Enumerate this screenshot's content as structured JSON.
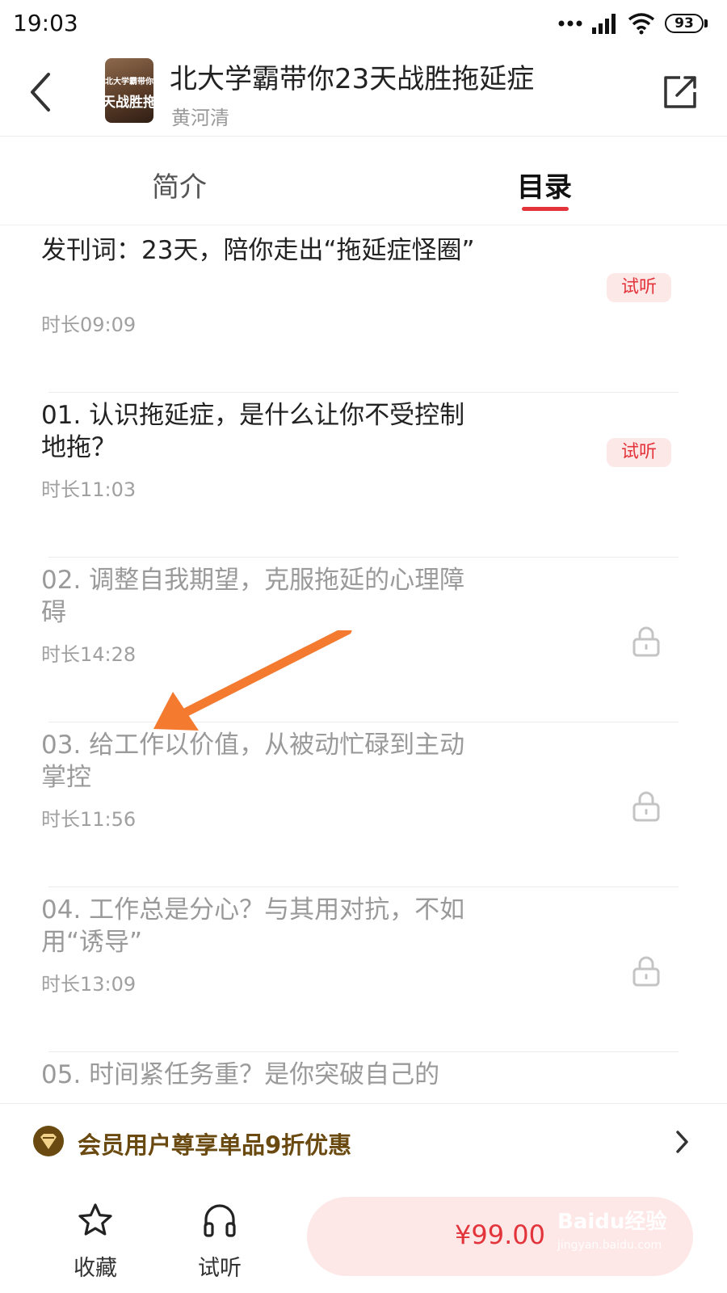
{
  "status_bar": {
    "time": "19:03",
    "battery": "93"
  },
  "header": {
    "title": "北大学霸带你23天战胜拖延症",
    "author": "黄河清",
    "cover_text_top": "北大学霸带你",
    "cover_text_main": "天战胜拖"
  },
  "tabs": [
    {
      "label": "简介",
      "active": false
    },
    {
      "label": "目录",
      "active": true
    }
  ],
  "chapters": [
    {
      "title": "发刊词：23天，陪你走出“拖延症怪圈”",
      "duration": "时长09:09",
      "badge": "试听",
      "locked": false
    },
    {
      "title": "01. 认识拖延症，是什么让你不受控制地拖？",
      "duration": "时长11:03",
      "badge": "试听",
      "locked": false
    },
    {
      "title": "02. 调整自我期望，克服拖延的心理障碍",
      "duration": "时长14:28",
      "badge": "",
      "locked": true
    },
    {
      "title": "03. 给工作以价值，从被动忙碌到主动掌控",
      "duration": "时长11:56",
      "badge": "",
      "locked": true
    },
    {
      "title": "04. 工作总是分心？与其用对抗，不如用“诱导”",
      "duration": "时长13:09",
      "badge": "",
      "locked": true
    },
    {
      "title": "05. 时间紧任务重？是你突破自己的",
      "duration": "",
      "badge": "",
      "locked": true
    }
  ],
  "member_bar": {
    "text": "会员用户尊享单品9折优惠"
  },
  "bottom_bar": {
    "favorite_label": "收藏",
    "listen_label": "试听",
    "price": "¥99.00"
  },
  "watermark": {
    "main": "Baidu经验",
    "sub": "jingyan.baidu.com"
  },
  "colors": {
    "accent": "#e2343a",
    "member_gold": "#6a4a10",
    "annotation_arrow": "#f47a30"
  }
}
